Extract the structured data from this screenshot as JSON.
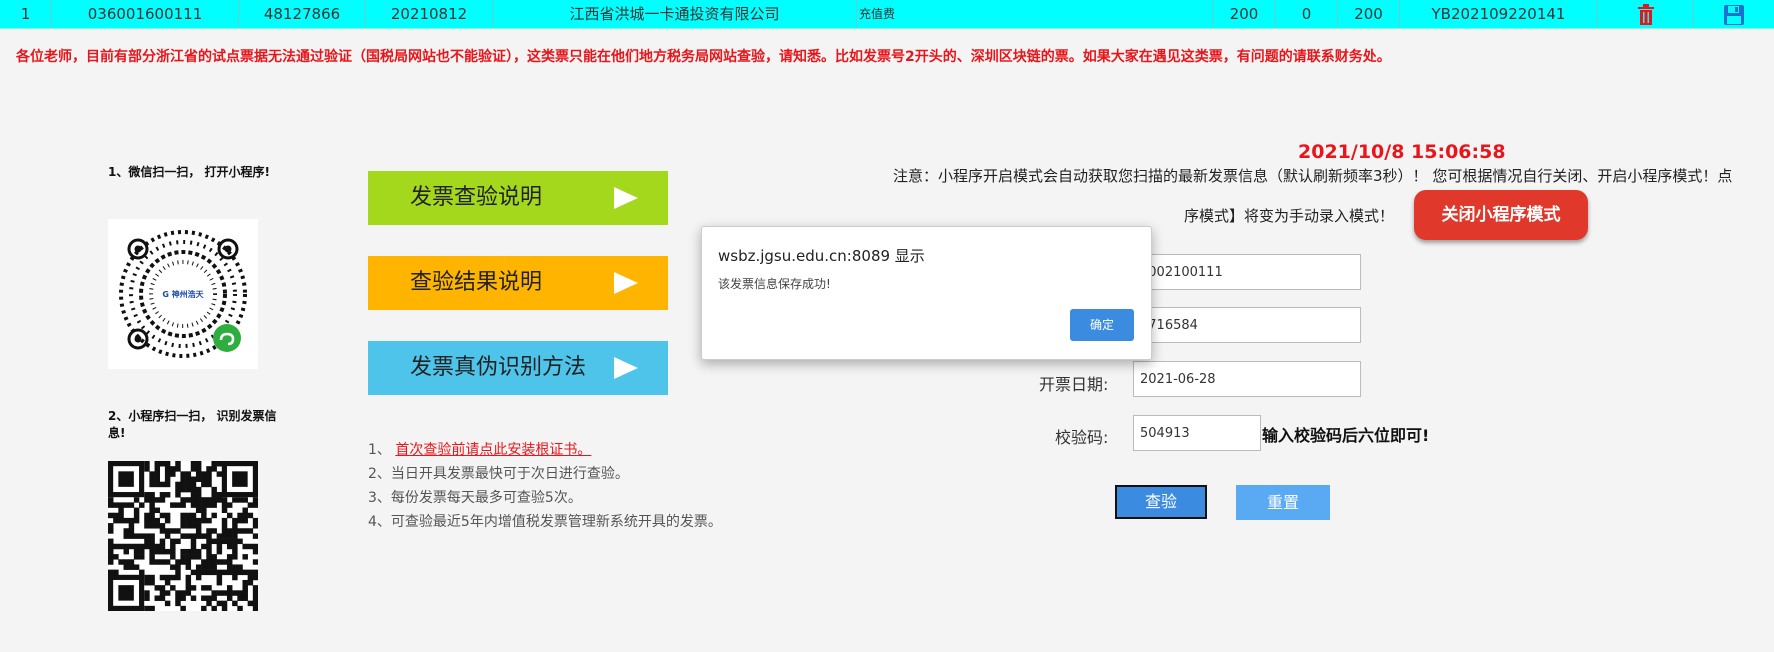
{
  "invoice_row": {
    "index": "1",
    "code": "036001600111",
    "number": "48127866",
    "date": "20210812",
    "seller": "江西省洪城一卡通投资有限公司",
    "item": "充值费",
    "amount": "200",
    "tax": "0",
    "total": "200",
    "ref": "YB202109220141"
  },
  "notice": "各位老师，目前有部分浙江省的试点票据无法通过验证（国税局网站也不能验证），这类票只能在他们地方税务局网站查验，请知悉。比如发票号2开头的、深圳区块链的票。如果大家在遇见这类票，有问题的请联系财务处。",
  "qr1": {
    "caption": "1、微信扫一扫，  打开小程序!",
    "logo_text": "神州浩天"
  },
  "qr2": {
    "caption": "2、小程序扫一扫，  识别发票信息!"
  },
  "buttons": {
    "invoice_guide": "发票查验说明",
    "result_guide": "查验结果说明",
    "auth_method": "发票真伪识别方法"
  },
  "tips": {
    "t1_prefix": "1、",
    "t1_link": "首次查验前请点此安装根证书。",
    "t2": "2、当日开具发票最快可于次日进行查验。",
    "t3": "3、每份发票每天最多可查验5次。",
    "t4": "4、可查验最近5年内增值税发票管理新系统开具的发票。"
  },
  "clock": "2021/10/8 15:06:58",
  "note_line1": "注意：小程序开启模式会自动获取您扫描的最新发票信息（默认刷新频率3秒）！ 您可根据情况自行关闭、开启小程序模式！点",
  "note_line2": "序模式】将变为手动录入模式！",
  "close_mode_button": "关闭小程序模式",
  "form": {
    "code_value": "3002100111",
    "number_value": "5716584",
    "date_label": "开票日期:",
    "date_value": "2021-06-28",
    "check_label": "校验码:",
    "check_value": "504913",
    "check_hint": "输入校验码后六位即可!",
    "query_button": "查验",
    "reset_button": "重置"
  },
  "dialog": {
    "title": "wsbz.jgsu.edu.cn:8089 显示",
    "message": "该发票信息保存成功!",
    "ok": "确定"
  },
  "colors": {
    "row_bg": "#00ffff",
    "btn_green": "#a3d81c",
    "btn_orange": "#ffb500",
    "btn_blue": "#4ec4ea",
    "accent_red": "#e8161b"
  }
}
